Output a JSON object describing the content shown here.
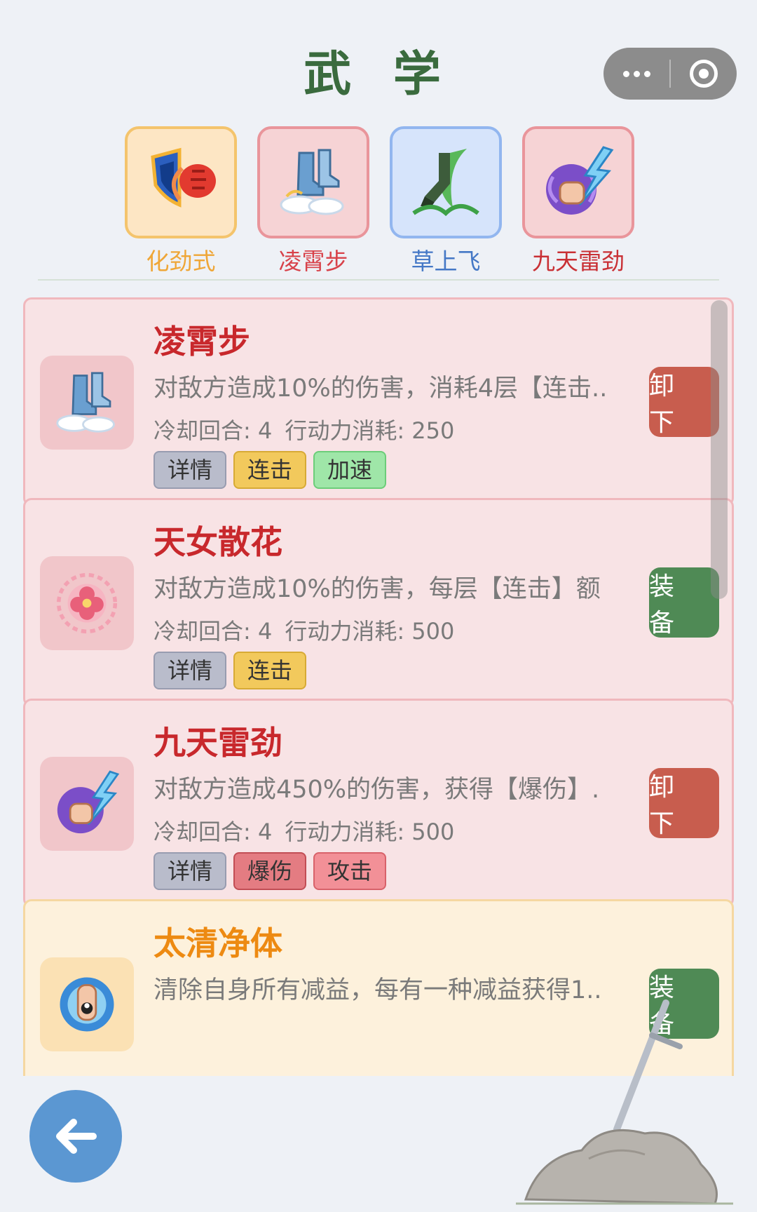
{
  "header": {
    "title": "武 学"
  },
  "slots": [
    {
      "label": "化劲式",
      "icon": "shield-fist-icon",
      "color": "#efa637",
      "bg": "#fde6c4",
      "border": "#f4c46c"
    },
    {
      "label": "凌霄步",
      "icon": "cloud-boots-icon",
      "color": "#d8424a",
      "bg": "#f6d3d5",
      "border": "#e9959b"
    },
    {
      "label": "草上飞",
      "icon": "grass-leap-icon",
      "color": "#4578c6",
      "bg": "#d6e4fb",
      "border": "#92b6ef"
    },
    {
      "label": "九天雷劲",
      "icon": "thunder-fist-icon",
      "color": "#c93035",
      "bg": "#f6d3d5",
      "border": "#e9959b"
    }
  ],
  "skills": [
    {
      "name": "凌霄步",
      "icon": "cloud-boots-icon",
      "desc": "对敌方造成10%的伤害，消耗4层【连击..",
      "cooldown": "冷却回合: 4",
      "cost": "行动力消耗: 250",
      "tags": [
        "详情",
        "连击",
        "加速"
      ],
      "action": "卸 下"
    },
    {
      "name": "天女散花",
      "icon": "flower-petals-icon",
      "desc": "对敌方造成10%的伤害，每层【连击】额",
      "cooldown": "冷却回合: 4",
      "cost": "行动力消耗: 500",
      "tags": [
        "详情",
        "连击"
      ],
      "action": "装 备"
    },
    {
      "name": "九天雷劲",
      "icon": "thunder-fist-icon",
      "desc": "对敌方造成450%的伤害，获得【爆伤】.",
      "cooldown": "冷却回合: 4",
      "cost": "行动力消耗: 500",
      "tags": [
        "详情",
        "爆伤",
        "攻击"
      ],
      "action": "卸 下"
    },
    {
      "name": "太清净体",
      "icon": "taiji-palm-icon",
      "desc": "清除自身所有减益，每有一种减益获得1..",
      "action": "装 备"
    }
  ],
  "colors": {
    "accent_green": "#3a6b3e",
    "unequip": "#c85d4e",
    "equip": "#4f8a55",
    "back": "#5b97d2"
  }
}
